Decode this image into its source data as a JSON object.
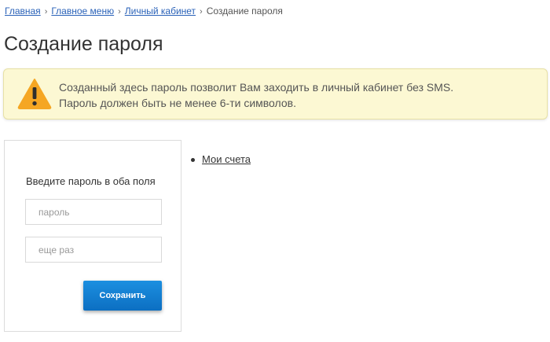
{
  "breadcrumb": {
    "items": [
      {
        "label": "Главная"
      },
      {
        "label": "Главное меню"
      },
      {
        "label": "Личный кабинет"
      }
    ],
    "current": "Создание пароля",
    "separator": "›"
  },
  "page": {
    "title": "Создание пароля"
  },
  "notice": {
    "icon": "warning-triangle-icon",
    "line1": "Созданный здесь пароль позволит Вам заходить в личный кабинет без SMS.",
    "line2": "Пароль должен быть не менее 6-ти символов.",
    "background_color": "#fcf8d3",
    "icon_color": "#f5a623"
  },
  "form": {
    "label": "Введите пароль в оба поля",
    "password_placeholder": "пароль",
    "password_value": "",
    "confirm_placeholder": "еще раз",
    "confirm_value": "",
    "save_label": "Сохранить",
    "button_color": "#1a86d9"
  },
  "sidebar": {
    "links": [
      {
        "label": "Мои счета"
      }
    ]
  }
}
